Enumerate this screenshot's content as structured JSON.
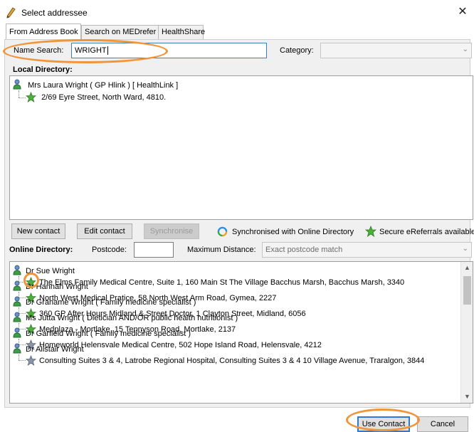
{
  "window": {
    "title": "Select addressee",
    "close_icon": "close-icon"
  },
  "tabs": [
    {
      "label": "From Address Book",
      "active": true
    },
    {
      "label": "Search on MEDrefer",
      "active": false
    },
    {
      "label": "HealthShare",
      "active": false
    }
  ],
  "search": {
    "name_label": "Name Search:",
    "name_value": "WRIGHT",
    "category_label": "Category:",
    "category_value": ""
  },
  "local_directory": {
    "label": "Local Directory:",
    "contact_name": "Mrs Laura Wright  ( GP Hlink )  [ HealthLink ]",
    "contact_address": "2/69 Eyre Street, North Ward, 4810."
  },
  "buttons": {
    "new_contact": "New contact",
    "edit_contact": "Edit contact",
    "synchronise": "Synchronise",
    "use_contact": "Use Contact",
    "cancel": "Cancel"
  },
  "legend": {
    "synced": "Synchronised with Online Directory",
    "secure": "Secure eReferrals available"
  },
  "online_directory": {
    "label": "Online Directory:",
    "postcode_label": "Postcode:",
    "postcode_value": "",
    "max_distance_label": "Maximum Distance:",
    "max_distance_value": "Exact postcode match",
    "results": [
      {
        "name": "Dr Sue Wright",
        "address": "The Elms Family Medical Centre, Suite 1, 160 Main St The Village Bacchus Marsh, Bacchus Marsh, 3340",
        "secure": true
      },
      {
        "name": "Dr Hannah Wright",
        "address": "North West Medical Pratice, 58 North West Arm Road, Gymea, 2227",
        "secure": true
      },
      {
        "name": "Dr Grahame Wright  ( Family medicine specialist )",
        "address": "360 GP After Hours Midland & Street Doctor, 1 Clayton Street, Midland, 6056",
        "secure": true
      },
      {
        "name": "Ms Jutta Wright  ( Dietician AND/OR public health nutritionist )",
        "address": "Medplaza - Mortlake, 15 Tennyson Road, Mortlake, 2137",
        "secure": true
      },
      {
        "name": "Dr Garfield Wright  ( Family medicine specialist )",
        "address": "Homeworld Helensvale Medical Centre, 502 Hope Island Road, Helensvale, 4212",
        "secure": false
      },
      {
        "name": "Dr Alistair Wright",
        "address": "Consulting Suites 3 & 4, Latrobe Regional Hospital, Consulting Suites 3 & 4 10 Village Avenue, Traralgon, 3844",
        "secure": false
      }
    ]
  },
  "colors": {
    "highlight_oval": "#f0963a",
    "secure_star": "#4caf3a",
    "plain_star": "#8a93a8",
    "default_button_border": "#2b7bd4"
  }
}
